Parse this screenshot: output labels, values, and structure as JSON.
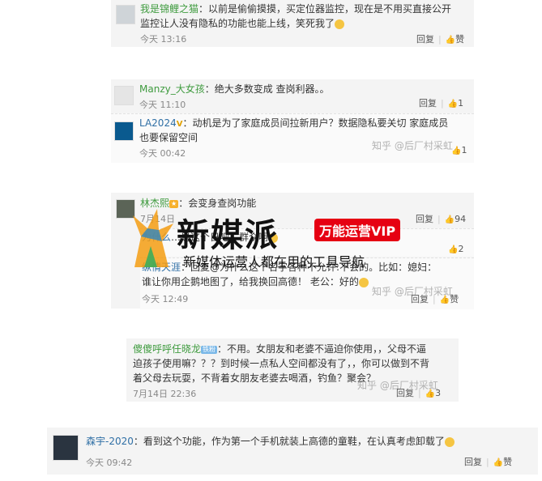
{
  "c1": {
    "user": "我是锦鲤之猫",
    "text1": "以前是偷偷摸摸，买定位器监控，现在是不用买直接公开",
    "text2": "监控让人没有隐私的功能也能上线，笑死我了",
    "time": "今天 13:16",
    "reply": "回复",
    "like": "赞"
  },
  "c2": {
    "user": "Manzy_大女孩",
    "text": "绝大多数变成 查岗利器。。",
    "time": "今天 11:10",
    "reply": "回复",
    "count": "1"
  },
  "c2s": {
    "user": "LA2024",
    "text1": "动机是为了家庭成员间拉新用户？数据隐私要关切 家庭成员",
    "text2": "也要保留空间",
    "time": "今天 00:42",
    "count": "1",
    "watermark": "知乎 @后厂村采虹"
  },
  "c3": {
    "user": "林杰熙",
    "text": "会变身查岗功能",
    "time": "7月14日",
    "reply": "回复",
    "count": "94"
  },
  "c3s1": {
    "user": "为什么",
    "text": "…是这个日吧！群众啊",
    "count": "2"
  },
  "c3s2": {
    "user": "纵情天涯",
    "text1": "回复@为什么这个名字各种不允许:不会的。比如：媳妇：",
    "text2": "谁让你用企鹅地图了，给我换回高德！ 老公：好的",
    "time": "今天 12:49",
    "reply": "回复",
    "like": "赞",
    "watermark": "知乎 @后厂村采虹"
  },
  "c4": {
    "user": "傻傻呼呼任晓龙",
    "badge": "铁粉",
    "text1": "不用。女朋友和老婆不逼迫你使用，，父母不逼",
    "text2": "迫孩子使用嘛？？？到时候一点私人空间都没有了，，你可以做到不背",
    "text3": "着父母去玩耍，不背着女朋友老婆去喝酒，钓鱼？聚会？",
    "time": "7月14日 22:36",
    "reply": "回复",
    "count": "3",
    "watermark": "知乎 @后厂村采虹"
  },
  "c5": {
    "user": "森宇-2020",
    "text": "看到这个功能，作为第一个手机就装上高德的童鞋，在认真考虑卸载了",
    "time": "今天 09:42",
    "reply": "回复",
    "like": "赞"
  },
  "banner": {
    "title": "新媒派",
    "vip": "万能运营VIP",
    "sub": "新媒体运营人都在用的工具导航"
  }
}
